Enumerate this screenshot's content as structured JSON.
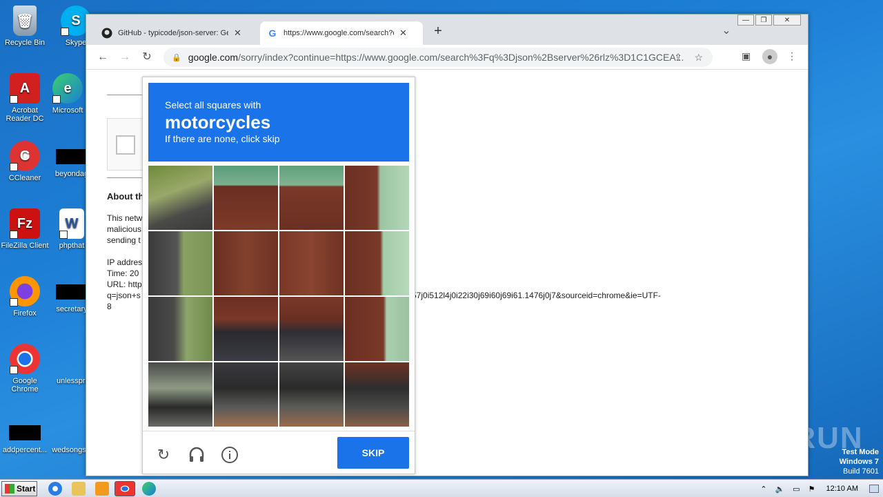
{
  "desktop": {
    "icons": [
      {
        "label": "Recycle Bin"
      },
      {
        "label": "Skype"
      },
      {
        "label": "Acrobat Reader DC"
      },
      {
        "label": "Microsoft"
      },
      {
        "label": "CCleaner"
      },
      {
        "label": "beyondag"
      },
      {
        "label": "FileZilla Client"
      },
      {
        "label": "phpthat"
      },
      {
        "label": "Firefox"
      },
      {
        "label": "secretary"
      },
      {
        "label": "Google Chrome"
      },
      {
        "label": "unlesspri"
      },
      {
        "label": "addpercent..."
      },
      {
        "label": "wedsongs"
      }
    ],
    "watermark": {
      "brand": "ANY RUN",
      "line1": "Test Mode",
      "line2": "Windows 7",
      "line3": "Build 7601"
    }
  },
  "browser": {
    "tabs": [
      {
        "title": "GitHub - typicode/json-server: Get a",
        "close": "✕"
      },
      {
        "title": "https://www.google.com/search?q=",
        "close": "✕"
      }
    ],
    "new_tab": "+",
    "tab_menu": "⌄",
    "url_host": "google.com",
    "url_rest": "/sorry/index?continue=https://www.google.com/search%3Fq%3Djson%2Bserver%26rlz%3D1C1GCEA..."
  },
  "page": {
    "about_heading": "About th",
    "line1": "This netw",
    "line2": "malicious",
    "line3": "sending t",
    "ip_label": "IP addres",
    "time_label": "Time: 20",
    "url_label": "URL: http",
    "url_cont1": "q=json+s",
    "url_cont_right": "57j0i512l4j0i22i30j69i60j69i61.1476j0j7&sourceid=chrome&ie=UTF-",
    "url_cont2": "8"
  },
  "captcha": {
    "instruction": "Select all squares with",
    "target": "motorcycles",
    "hint": "If there are none, click skip",
    "skip_label": "SKIP"
  },
  "taskbar": {
    "start_label": "Start",
    "clock": "12:10 AM"
  }
}
